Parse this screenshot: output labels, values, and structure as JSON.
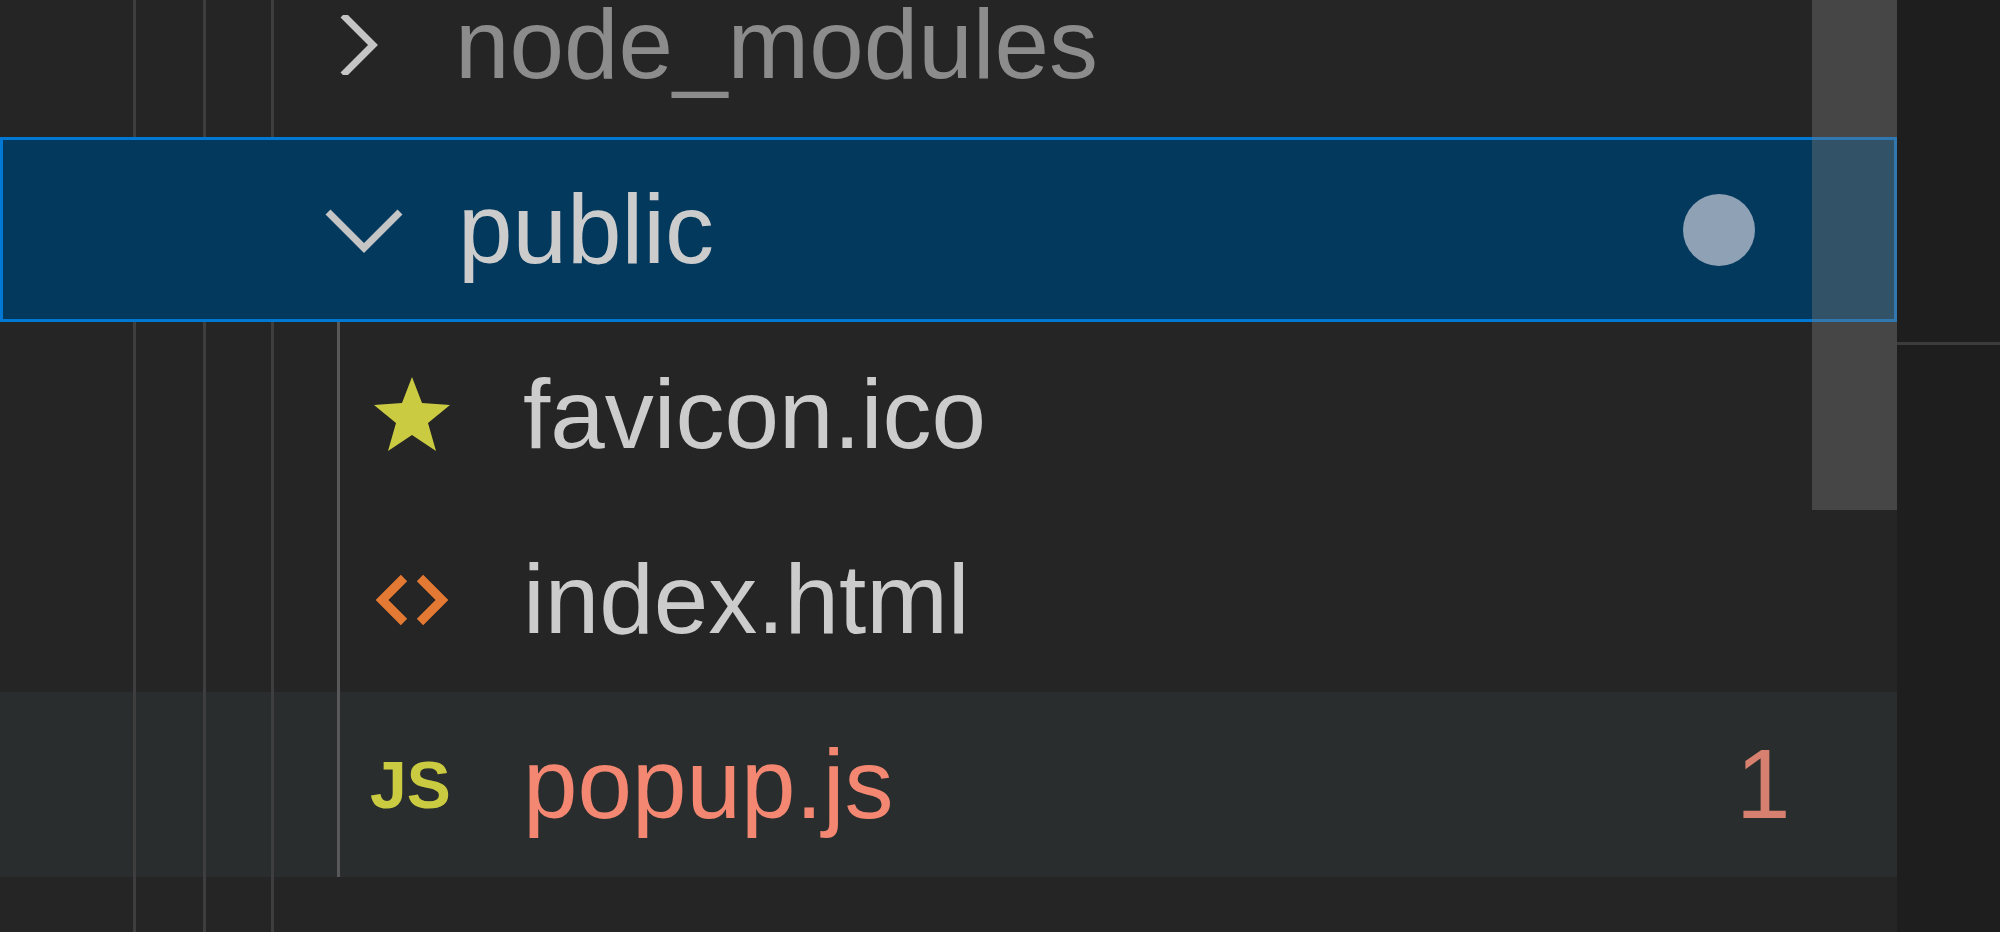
{
  "tree": [
    {
      "label": "node_modules",
      "kind": "folder",
      "expanded": false,
      "selected": false,
      "dimmed": true
    },
    {
      "label": "public",
      "kind": "folder",
      "expanded": true,
      "selected": true,
      "dimmed": false,
      "modified": true,
      "children": [
        {
          "label": "favicon.ico",
          "kind": "favicon",
          "selected": false,
          "dimmed": false,
          "hovered": false,
          "error": false
        },
        {
          "label": "index.html",
          "kind": "html",
          "selected": false,
          "dimmed": false,
          "hovered": false,
          "error": false
        },
        {
          "label": "popup.js",
          "kind": "js",
          "icon_label": "JS",
          "selected": false,
          "dimmed": false,
          "hovered": true,
          "error": true,
          "problems": "1"
        }
      ]
    }
  ]
}
